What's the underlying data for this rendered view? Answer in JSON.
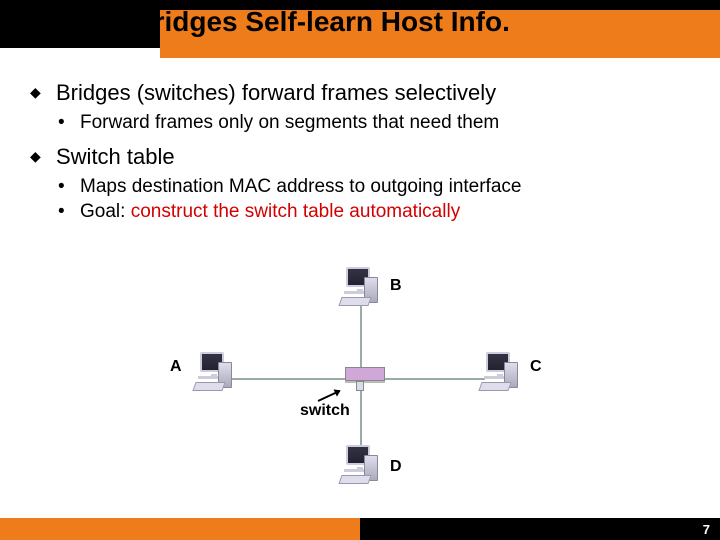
{
  "title": "Ethernet Bridges Self-learn Host Info.",
  "bullets": {
    "b1a": "Bridges (switches) forward frames selectively",
    "b2a": "Forward frames only on segments that need them",
    "b1b": "Switch table",
    "b2b": "Maps destination MAC address to outgoing interface",
    "b2c_pre": "Goal: ",
    "b2c_red": "construct the switch table automatically"
  },
  "diagram": {
    "A": "A",
    "B": "B",
    "C": "C",
    "D": "D",
    "switch": "switch"
  },
  "page": "7"
}
